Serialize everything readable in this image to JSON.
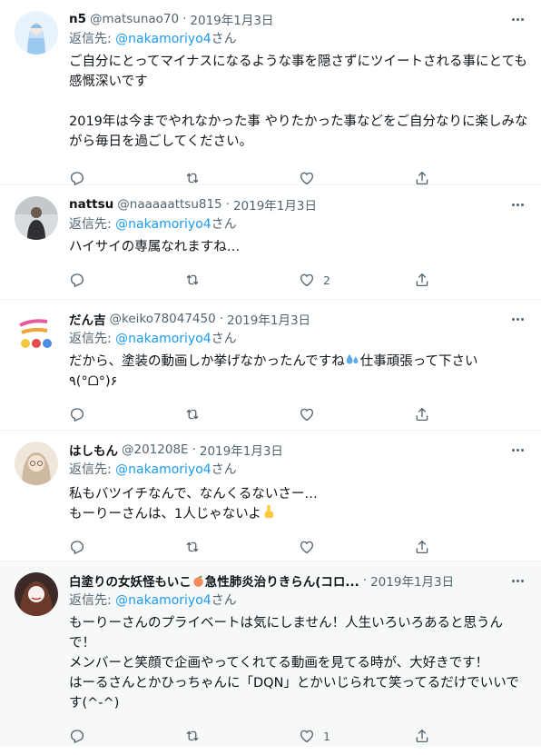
{
  "reply_prefix": "返信先: ",
  "tweets": [
    {
      "name": "n5",
      "handle": "@matsunao70",
      "separator": "·",
      "date": "2019年1月3日",
      "mention": "@nakamoriyo4",
      "mention_suffix": "さん",
      "text": "ご自分にとってマイナスになるような事を隠さずにツイートされる事にとても感慨深いです\n\n2019年は今までやれなかった事 やりたかった事などをご自分なりに楽しみながら毎日を過ごしてください。",
      "like_count": ""
    },
    {
      "name": "nattsu",
      "handle": "@naaaaattsu815",
      "separator": "·",
      "date": "2019年1月3日",
      "mention": "@nakamoriyo4",
      "mention_suffix": "さん",
      "text": "ハイサイの専属なれますね…",
      "like_count": "2"
    },
    {
      "name": "だん吉",
      "handle": "@keiko78047450",
      "separator": "·",
      "date": "2019年1月3日",
      "mention": "@nakamoriyo4",
      "mention_suffix": "さん",
      "text_before": "だから、塗装の動画しか挙げなかったんですね",
      "text_after": "仕事頑張って下さい\n٩(°ᗝ°)۶",
      "like_count": ""
    },
    {
      "name": "はしもん",
      "handle": "@201208E",
      "separator": "·",
      "date": "2019年1月3日",
      "mention": "@nakamoriyo4",
      "mention_suffix": "さん",
      "text_before": "私もバツイチなんで、なんくるないさー…\nもーりーさんは、1人じゃないよ",
      "like_count": ""
    },
    {
      "name_before": "白塗りの女妖怪もいこ",
      "name_after": "急性肺炎治りきらん(コロ...",
      "separator": "·",
      "date": "2019年1月3日",
      "mention": "@nakamoriyo4",
      "mention_suffix": "さん",
      "text": "もーりーさんのプライベートは気にしません！人生いろいろあると思うんで！\nメンバーと笑顔で企画やってくれてる動画を見てる時が、大好きです！\nはーるさんとかひっちゃんに「DQN」とかいじられて笑ってるだけでいいです(^-^)",
      "like_count": "1"
    }
  ],
  "icons": {
    "reply": "reply-icon",
    "retweet": "retweet-icon",
    "like": "like-icon",
    "share": "share-icon",
    "more": "more-icon",
    "sweat": "sweat-droplets-icon",
    "pointing": "pointing-up-icon",
    "peach": "peach-icon"
  },
  "colors": {
    "link": "#1d9bf0",
    "secondary": "#536471",
    "text": "#0f1419",
    "divider": "#eff3f4"
  }
}
